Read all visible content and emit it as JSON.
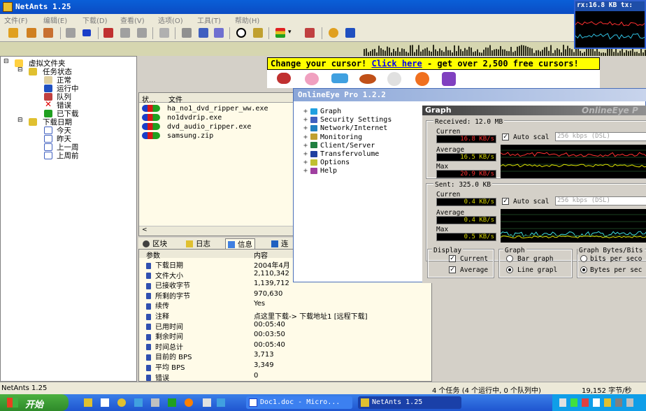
{
  "app": {
    "title": "NetAnts 1.25"
  },
  "menu": [
    "文件(F)",
    "编辑(E)",
    "下载(D)",
    "查看(V)",
    "选项(O)",
    "工具(T)",
    "帮助(H)"
  ],
  "banner": {
    "pre": "Change your cursor! ",
    "link": "Click here",
    "post": " - get over 2,500 free cursors!"
  },
  "tree": {
    "root": "虚拟文件夹",
    "status_group": "任务状态",
    "status_items": [
      "正常",
      "运行中",
      "队列",
      "错误",
      "已下载"
    ],
    "date_group": "下载日期",
    "date_items": [
      "今天",
      "昨天",
      "上一周",
      "上周前"
    ]
  },
  "filelist": {
    "headers": [
      "状...",
      "文件"
    ],
    "files": [
      "ha_no1_dvd_ripper_ww.exe",
      "no1dvdrip.exe",
      "dvd_audio_ripper.exe",
      "samsung.zip"
    ]
  },
  "tabs": [
    "区块",
    "日志",
    "信息",
    "连"
  ],
  "props": {
    "headers": [
      "参数",
      "内容"
    ],
    "rows": [
      {
        "k": "下载日期",
        "v": "2004年4月"
      },
      {
        "k": "文件大小",
        "v": "2,110,342"
      },
      {
        "k": "已接收字节",
        "v": "1,139,712"
      },
      {
        "k": "所剩的字节",
        "v": "970,630"
      },
      {
        "k": "续传",
        "v": "Yes"
      },
      {
        "k": "注释",
        "v": "点这里下载-> 下载地址1 [远程下载]"
      },
      {
        "k": "已用时间",
        "v": "00:05:40"
      },
      {
        "k": "剩余时间",
        "v": "00:03:50"
      },
      {
        "k": "时间总计",
        "v": "00:05:40"
      },
      {
        "k": "目前的 BPS",
        "v": "3,713"
      },
      {
        "k": "平均 BPS",
        "v": "3,349"
      },
      {
        "k": "错误",
        "v": "0"
      }
    ]
  },
  "status": {
    "left": "NetAnts 1.25",
    "tasks": "4 个任务 (4 个运行中, 0 个队列中)",
    "speed": "19,152 字节/秒"
  },
  "taskbar": {
    "start": "开始",
    "tasks": [
      "Doc1.doc - Micro...",
      "NetAnts 1.25"
    ]
  },
  "mini": {
    "title": "rx:16.8 KB  tx:"
  },
  "oe": {
    "title": "OnlineEye Pro 1.2.2",
    "tree": [
      "Graph",
      "Security Settings",
      "Network/Internet",
      "Monitoring",
      "Client/Server",
      "Transfervolume",
      "Options",
      "Help"
    ],
    "panel_title": "Graph",
    "brand": "OnlineEye P",
    "received": {
      "label": "Received: 12.0 MB",
      "current_label": "Curren",
      "current": "16.8 KB/s",
      "average_label": "Average",
      "average": "16.5 KB/s",
      "max_label": "Max",
      "max": "20.9 KB/s",
      "auto_label": "Auto scal",
      "scale": "256 kbps (DSL)"
    },
    "sent": {
      "label": "Sent: 325.0 KB",
      "current_label": "Curren",
      "current": "0.4 KB/s",
      "average_label": "Average",
      "average": "0.4 KB/s",
      "max_label": "Max",
      "max": "0.5 KB/s",
      "auto_label": "Auto scal",
      "scale": "256 kbps (DSL)"
    },
    "display": {
      "label": "Display",
      "current": "Current",
      "average": "Average"
    },
    "graph": {
      "label": "Graph",
      "bar": "Bar graph",
      "line": "Line grapl"
    },
    "bytes": {
      "label": "Graph Bytes/Bits",
      "bits": "bits per seco",
      "bytes": "Bytes per sec"
    }
  }
}
